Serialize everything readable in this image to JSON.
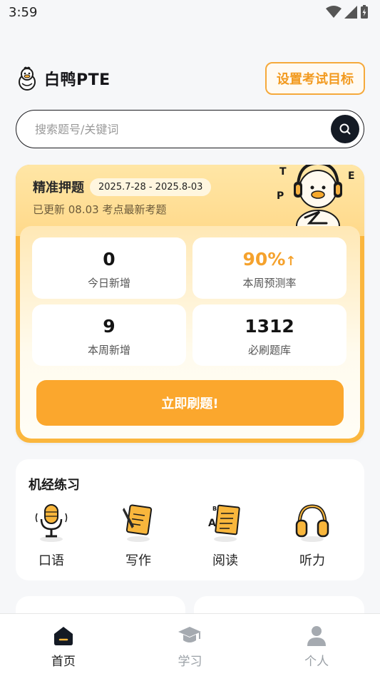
{
  "status_bar": {
    "time": "3:59"
  },
  "header": {
    "brand_name": "白鸭PTE",
    "goal_button": "设置考试目标"
  },
  "search": {
    "placeholder": "搜索题号/关键词"
  },
  "prediction_card": {
    "title": "精准押题",
    "date_range": "2025.7-28 - 2025.8-03",
    "subtitle": "已更新 08.03 考点最新考题",
    "mascot_letters": [
      "T",
      "P",
      "E"
    ],
    "stats": [
      {
        "value": "0",
        "label": "今日新增"
      },
      {
        "value": "90%",
        "arrow": "↑",
        "label": "本周预测率"
      },
      {
        "value": "9",
        "label": "本周新增"
      },
      {
        "value": "1312",
        "label": "必刷题库"
      }
    ],
    "cta": "立即刷题!"
  },
  "practice": {
    "title": "机经练习",
    "items": [
      {
        "label": "口语",
        "icon": "microphone-icon"
      },
      {
        "label": "写作",
        "icon": "notebook-pen-icon"
      },
      {
        "label": "阅读",
        "icon": "reading-doc-icon"
      },
      {
        "label": "听力",
        "icon": "headphones-icon"
      }
    ]
  },
  "bottom_nav": {
    "items": [
      {
        "label": "首页",
        "icon": "home-icon",
        "active": true
      },
      {
        "label": "学习",
        "icon": "graduation-cap-icon",
        "active": false
      },
      {
        "label": "个人",
        "icon": "person-icon",
        "active": false
      }
    ]
  },
  "colors": {
    "accent": "#fba72d",
    "card_bg": "#fbb63d",
    "dark": "#141a24"
  }
}
